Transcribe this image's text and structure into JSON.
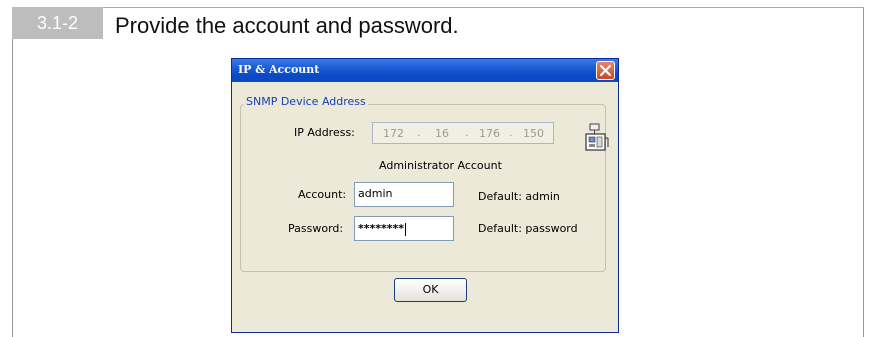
{
  "step": {
    "number": "3.1-2",
    "title": "Provide the account and password."
  },
  "dialog": {
    "title": "IP & Account",
    "group_label": "SNMP Device Address",
    "ip_label": "IP Address:",
    "ip": [
      "172",
      "16",
      "176",
      "150"
    ],
    "admin_heading": "Administrator Account",
    "account_label": "Account:",
    "account_value": "admin",
    "account_default": "Default: admin",
    "password_label": "Password:",
    "password_masked": "********",
    "password_default": "Default: password",
    "ok_label": "OK"
  },
  "icons": {
    "close": "close-icon",
    "device": "network-device-icon"
  },
  "colors": {
    "titlebar": "#0b49c6",
    "dialog_bg": "#ece9d8",
    "group_label": "#1a3fb0",
    "close_button": "#c8492b",
    "step_badge": "#bdbdbd"
  }
}
